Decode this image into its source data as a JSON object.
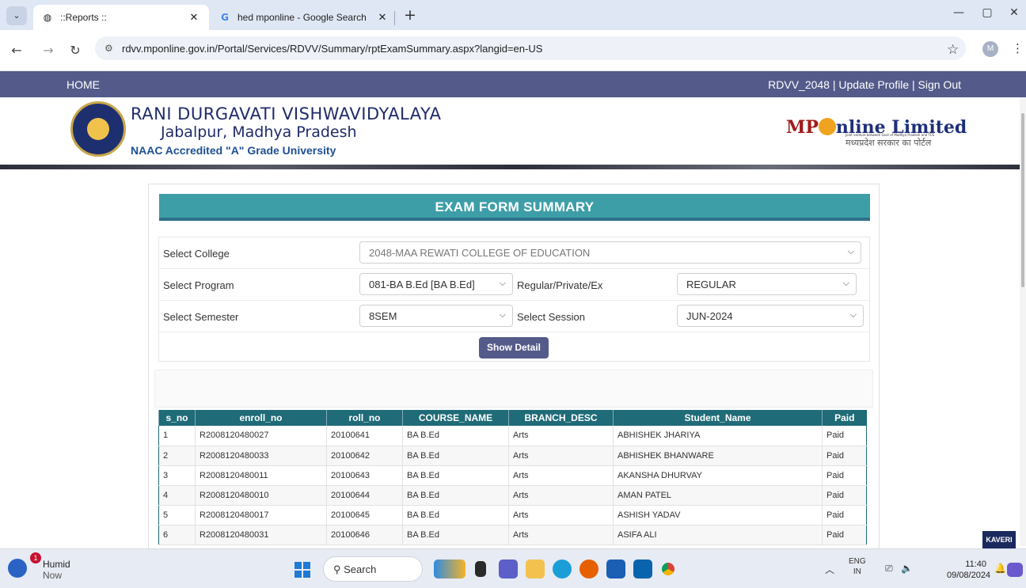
{
  "browser": {
    "tabs": [
      {
        "title": "::Reports ::",
        "active": true,
        "icon": "globe-icon"
      },
      {
        "title": "hed mponline - Google Search",
        "active": false,
        "icon": "google-icon"
      }
    ],
    "url": "rdvv.mponline.gov.in/Portal/Services/RDVV/Summary/rptExamSummary.aspx?langid=en-US",
    "profile_initial": "M"
  },
  "site": {
    "nav_home": "HOME",
    "nav_right": "RDVV_2048 | Update Profile | Sign Out",
    "univ_line1": "RANI DURGAVATI VISHWAVIDYALAYA",
    "univ_line2": "Jabalpur, Madhya Pradesh",
    "univ_line3": "NAAC Accredited \"A\" Grade University",
    "mp_logo_a": "MP",
    "mp_logo_b": "nline Limited",
    "mp_sub": "Joint venture between Govt of Madhya Pradesh and TCS",
    "mp_hindi": "मध्यप्रदेश सरकार का पोर्टल"
  },
  "form": {
    "title": "EXAM FORM SUMMARY",
    "college_label": "Select College",
    "college_value": "2048-MAA REWATI COLLEGE OF EDUCATION",
    "program_label": "Select Program",
    "program_value": "081-BA B.Ed [BA B.Ed]",
    "type_label": "Regular/Private/Ex",
    "type_value": "REGULAR",
    "semester_label": "Select Semester",
    "semester_value": "8SEM",
    "session_label": "Select Session",
    "session_value": "JUN-2024",
    "show_button": "Show Detail"
  },
  "table": {
    "headers": [
      "s_no",
      "enroll_no",
      "roll_no",
      "COURSE_NAME",
      "BRANCH_DESC",
      "Student_Name",
      "Paid"
    ],
    "rows": [
      [
        "1",
        "R2008120480027",
        "20100641",
        "BA B.Ed",
        "Arts",
        "ABHISHEK JHARIYA",
        "Paid"
      ],
      [
        "2",
        "R2008120480033",
        "20100642",
        "BA B.Ed",
        "Arts",
        "ABHISHEK BHANWARE",
        "Paid"
      ],
      [
        "3",
        "R2008120480011",
        "20100643",
        "BA B.Ed",
        "Arts",
        "AKANSHA DHURVAY",
        "Paid"
      ],
      [
        "4",
        "R2008120480010",
        "20100644",
        "BA B.Ed",
        "Arts",
        "AMAN PATEL",
        "Paid"
      ],
      [
        "5",
        "R2008120480017",
        "20100645",
        "BA B.Ed",
        "Arts",
        "ASHISH YADAV",
        "Paid"
      ],
      [
        "6",
        "R2008120480031",
        "20100646",
        "BA B.Ed",
        "Arts",
        "ASIFA ALI",
        "Paid"
      ]
    ]
  },
  "widget": {
    "kaveri": "KAVERI"
  },
  "taskbar": {
    "weather_title": "Humid",
    "weather_sub": "Now",
    "notif_count": "1",
    "search_label": "Search",
    "lang_1": "ENG",
    "lang_2": "IN",
    "time": "11:40",
    "date": "09/08/2024"
  }
}
